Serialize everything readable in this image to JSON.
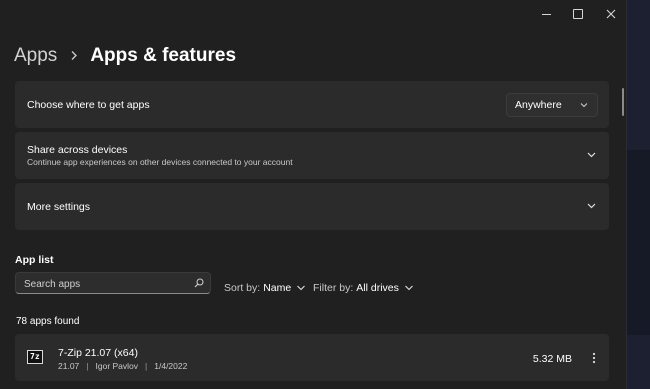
{
  "window": {
    "controls": {
      "minimize": "minimize-icon",
      "maximize": "maximize-icon",
      "close": "close-icon"
    }
  },
  "breadcrumb": {
    "parent": "Apps",
    "separator_icon": "chevron-right-icon",
    "current": "Apps & features"
  },
  "settings": {
    "where_to_get": {
      "title": "Choose where to get apps",
      "value": "Anywhere"
    },
    "share": {
      "title": "Share across devices",
      "subtitle": "Continue app experiences on other devices connected to your account"
    },
    "more": {
      "title": "More settings"
    }
  },
  "app_list": {
    "title": "App list",
    "search_placeholder": "Search apps",
    "sort_label": "Sort by:",
    "sort_value": "Name",
    "filter_label": "Filter by:",
    "filter_value": "All drives",
    "count_text": "78 apps found",
    "items": [
      {
        "name": "7-Zip 21.07 (x64)",
        "version": "21.07",
        "publisher": "Igor Pavlov",
        "date": "1/4/2022",
        "size": "5.32 MB",
        "icon_text": "7z"
      }
    ]
  },
  "colors": {
    "background": "#202020",
    "card": "#2b2b2b",
    "text": "#ffffff",
    "subtext": "#c9c9c9"
  }
}
